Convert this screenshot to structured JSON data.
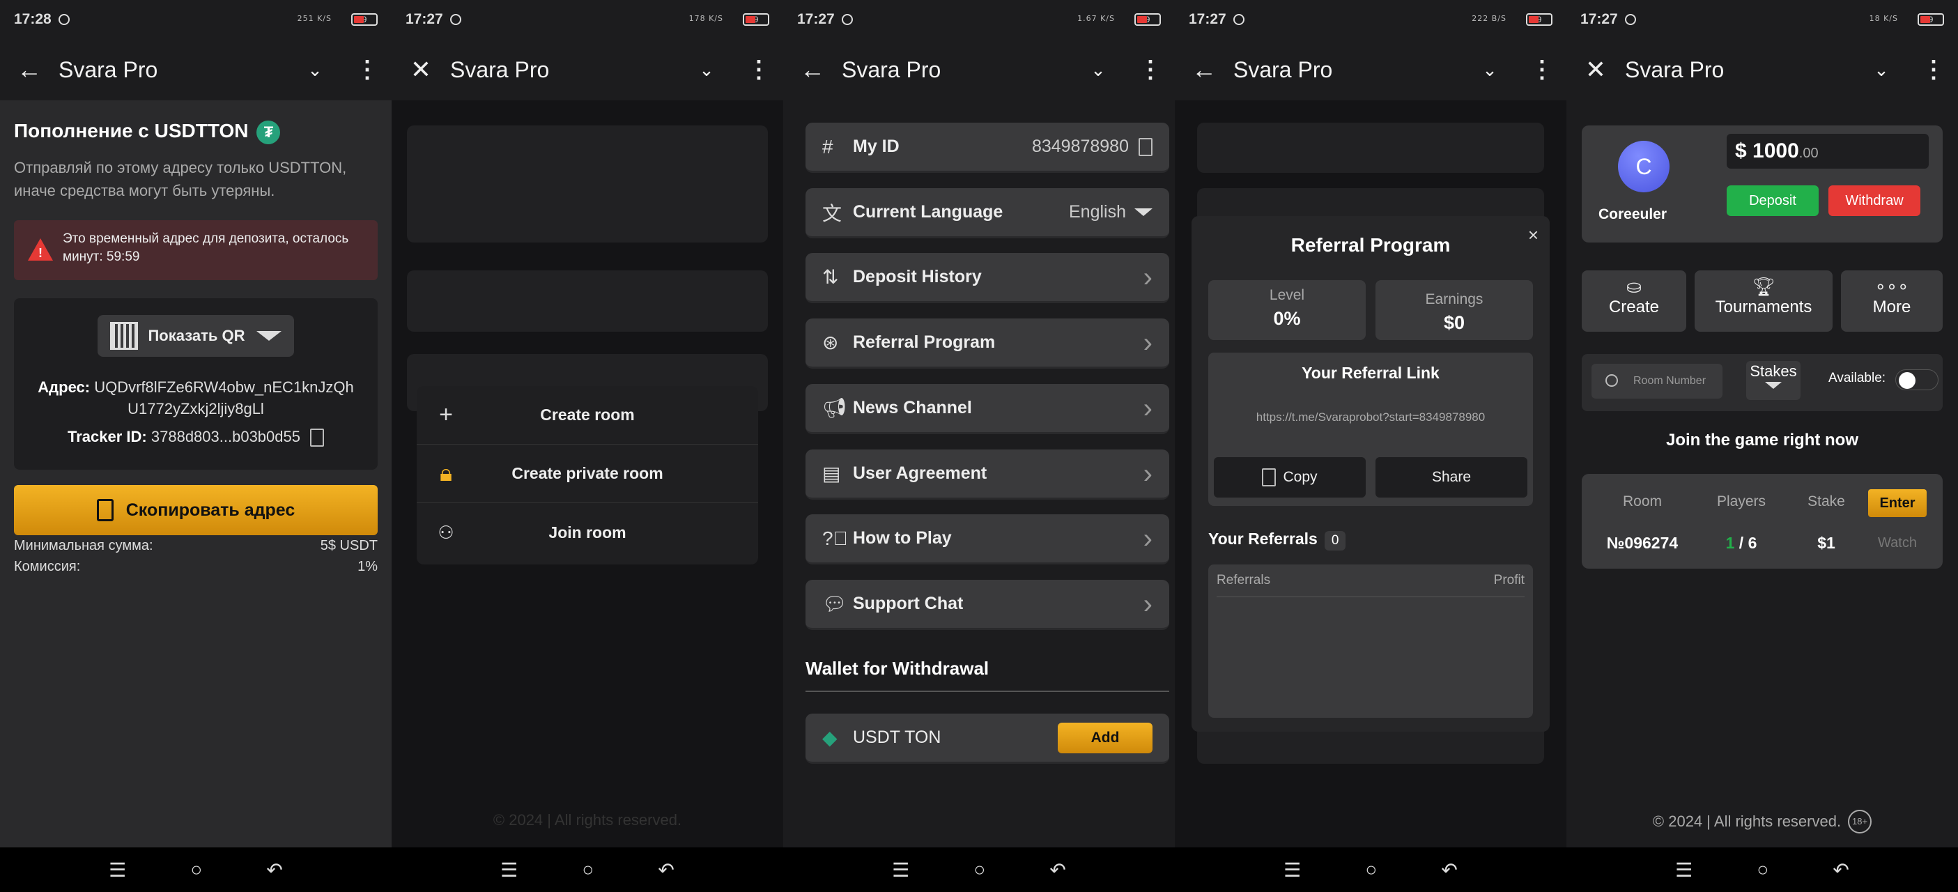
{
  "app_title": "Svara Pro",
  "panels": [
    {
      "time": "17:28",
      "battery": "9",
      "net": "251 K/S"
    },
    {
      "time": "17:27",
      "battery": "9",
      "net": "178 K/S"
    },
    {
      "time": "17:27",
      "battery": "9",
      "net": "1.67 K/S"
    },
    {
      "time": "17:27",
      "battery": "9",
      "net": "222 B/S"
    },
    {
      "time": "17:27",
      "battery": "9",
      "net": "18 K/S"
    }
  ],
  "deposit": {
    "title": "Пополнение с USDTTON",
    "subtitle": "Отправляй по этому адресу только USDTTON, иначе средства могут быть утеряны.",
    "warning": "Это временный адрес для депозита, осталось минут: 59:59",
    "qr_label": "Показать QR",
    "address_label": "Адрес:",
    "address": "UQDvrf8lFZe6RW4obw_nEC1knJzQhU1772yZxkj2ljiy8gLl",
    "tracker_label": "Tracker ID:",
    "tracker": "3788d803...b03b0d55",
    "copy_label": "Скопировать адрес",
    "min_label": "Минимальная сумма:",
    "min_value": "5$ USDT",
    "fee_label": "Комиссия:",
    "fee_value": "1%"
  },
  "create_menu": {
    "items": [
      {
        "label": "Create room",
        "icon": "plus-icon"
      },
      {
        "label": "Create private room",
        "icon": "lock-icon"
      },
      {
        "label": "Join room",
        "icon": "people-icon"
      }
    ]
  },
  "settings": {
    "my_id_label": "My ID",
    "my_id": "8349878980",
    "language_label": "Current Language",
    "language": "English",
    "items": [
      "Deposit History",
      "Referral Program",
      "News Channel",
      "User Agreement",
      "How to Play",
      "Support Chat"
    ],
    "wallet_heading": "Wallet for Withdrawal",
    "wallet_name": "USDT TON",
    "add_label": "Add"
  },
  "referral": {
    "title": "Referral Program",
    "close": "×",
    "level_label": "Level",
    "level": "0%",
    "earnings_label": "Earnings",
    "earnings": "$0",
    "link_title": "Your Referral Link",
    "link": "https://t.me/Svaraprobot?start=8349878980",
    "copy_label": "Copy",
    "share_label": "Share",
    "referrals_title": "Your Referrals",
    "referrals_count": "0",
    "col_referrals": "Referrals",
    "col_profit": "Profit"
  },
  "lobby": {
    "avatar_letter": "C",
    "username": "Coreeuler",
    "balance_main": "$ 1000",
    "balance_cents": ".00",
    "deposit_label": "Deposit",
    "withdraw_label": "Withdraw",
    "tiles": [
      {
        "label": "Create",
        "icon": "chip-icon"
      },
      {
        "label": "Tournaments",
        "icon": "trophy-icon"
      },
      {
        "label": "More",
        "icon": "dots-icon"
      }
    ],
    "room_placeholder": "Room Number",
    "stakes_label": "Stakes",
    "available_label": "Available:",
    "join_heading": "Join the game right now",
    "columns": {
      "room": "Room",
      "players": "Players",
      "stake": "Stake"
    },
    "enter_label": "Enter",
    "room": {
      "number": "№096274",
      "players_now": "1",
      "players_max": "/ 6",
      "stake": "$1",
      "watch": "Watch"
    },
    "footer": "© 2024 | All rights reserved.",
    "age": "18+"
  },
  "blurred_footer": "© 2024 | All rights reserved."
}
